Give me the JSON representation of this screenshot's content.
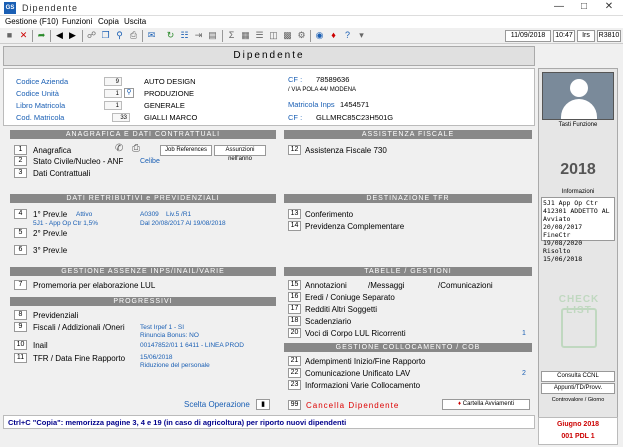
{
  "window": {
    "title": "Dipendente",
    "app_icon": "GS"
  },
  "menu": [
    "Gestione (F10)",
    "Funzioni",
    "Copia",
    "Uscita"
  ],
  "toolbar_status": {
    "date": "11/09/2018",
    "time": "10:47",
    "user": "Irs",
    "release": "R3810"
  },
  "header": {
    "title": "Dipendente"
  },
  "ident": {
    "codice_azienda_label": "Codice Azienda",
    "codice_azienda_num": "9",
    "codice_azienda_val": "AUTO DESIGN",
    "codice_unita_label": "Codice Unità",
    "codice_unita_num": "1",
    "codice_unita_val": "PRODUZIONE",
    "libro_label": "Libro Matricola",
    "libro_num": "1",
    "libro_val": "GENERALE",
    "cod_matricola_label": "Cod. Matricola",
    "cod_matricola_num": "33",
    "cod_matricola_val": "GIALLI MARCO",
    "cf_label": "CF :",
    "cf_az": "78589636",
    "address": "/ VIA POLA 44/ MODENA",
    "inps_label": "Matricola Inps",
    "inps_val": "1454571",
    "cf2_label": "CF :",
    "cf_dip": "GLLMRC85C23H501G"
  },
  "anagrafica": {
    "title": "ANAGRAFICA E DATI CONTRATTUALI",
    "items": [
      {
        "n": "1",
        "label": "Anagrafica"
      },
      {
        "n": "2",
        "label": "Stato Civile/Nucleo  - ANF",
        "extra": "Celibe"
      },
      {
        "n": "3",
        "label": "Dati Contrattuali"
      }
    ],
    "job_references": "Job References",
    "assunzioni": "Assunzioni nell'anno"
  },
  "assistenza": {
    "title": "ASSISTENZA FISCALE",
    "items": [
      {
        "n": "12",
        "label": "Assistenza Fiscale 730"
      }
    ]
  },
  "retributivi": {
    "title": "DATI RETRIBUTIVI e PREVIDENZIALI",
    "items": [
      {
        "n": "4",
        "label": "1° Prev.le",
        "status": "Attivo",
        "code": "A0309",
        "liv": "Liv.5 /R1",
        "sub": "5J1 - App Op Ctr 1,5%",
        "dates": "Dal 20/08/2017  Al 19/08/2018"
      },
      {
        "n": "5",
        "label": "2° Prev.le"
      },
      {
        "n": "6",
        "label": "3° Prev.le"
      }
    ]
  },
  "destinazione": {
    "title": "DESTINAZIONE TFR",
    "items": [
      {
        "n": "13",
        "label": "Conferimento"
      },
      {
        "n": "14",
        "label": "Previdenza Complementare"
      }
    ]
  },
  "gestione": {
    "title": "GESTIONE ASSENZE INPS/INAIL/VARIE",
    "items": [
      {
        "n": "7",
        "label": "Promemoria per elaborazione LUL"
      }
    ]
  },
  "progressivi": {
    "title": "PROGRESSIVI",
    "items": [
      {
        "n": "8",
        "label": "Previdenziali"
      },
      {
        "n": "9",
        "label": "Fiscali / Addizionali /Oneri",
        "info1": "Test Irpef  1 - SI",
        "info2": "Rinuncia Bonus: NO"
      },
      {
        "n": "10",
        "label": "Inail",
        "info1": "00147852/01  1 6411 - LINEA PROD"
      },
      {
        "n": "11",
        "label": "TFR / Data Fine Rapporto",
        "info1": "15/06/2018",
        "info2": "Riduzione del personale"
      }
    ]
  },
  "tabelle": {
    "title": "TABELLE / GESTIONI",
    "items": [
      {
        "n": "15",
        "label": "Annotazioni",
        "label2": "/Messaggi",
        "label3": "/Comunicazioni"
      },
      {
        "n": "16",
        "label": "Eredi / Coniuge Separato"
      },
      {
        "n": "17",
        "label": "Redditi Altri Soggetti"
      },
      {
        "n": "18",
        "label": "Scadenziario"
      },
      {
        "n": "20",
        "label": "Voci di Corpo LUL Ricorrenti",
        "count": "1"
      }
    ]
  },
  "collocamento": {
    "title": "GESTIONE COLLOCAMENTO / COB",
    "items": [
      {
        "n": "21",
        "label": "Adempimenti Inizio/Fine Rapporto"
      },
      {
        "n": "22",
        "label": "Comunicazione Unificato LAV",
        "count": "2"
      },
      {
        "n": "23",
        "label": "Informazioni  Varie  Collocamento"
      }
    ]
  },
  "footer_actions": {
    "scelta": "Scelta Operazione",
    "cancella_n": "99",
    "cancella": "Cancella Dipendente",
    "cartella": "Cartella Avviamenti"
  },
  "right": {
    "tasti": "Tasti Funzione",
    "year": "2018",
    "informazioni": "Informazioni",
    "info_lines": [
      "5J1    App Op Ctr",
      "412301  ADDETTO AL",
      "",
      "Avviato 20/08/2017",
      "FineCtr 19/08/2020",
      "Risolto 15/06/2018"
    ],
    "check_list": "CHECK LIST",
    "consulta": "Consulta CCNL",
    "appunti": "Appunti/TD/Provv.",
    "controvalore": "Controvalore / Giorno",
    "period": "Giugno   2018",
    "pdl": "001 PDL 1"
  },
  "status": {
    "message": "Ctrl+C \"Copia\": memorizza pagine  3, 4 e 19 (in caso di agricoltura) per riporto nuovi dipendenti"
  }
}
